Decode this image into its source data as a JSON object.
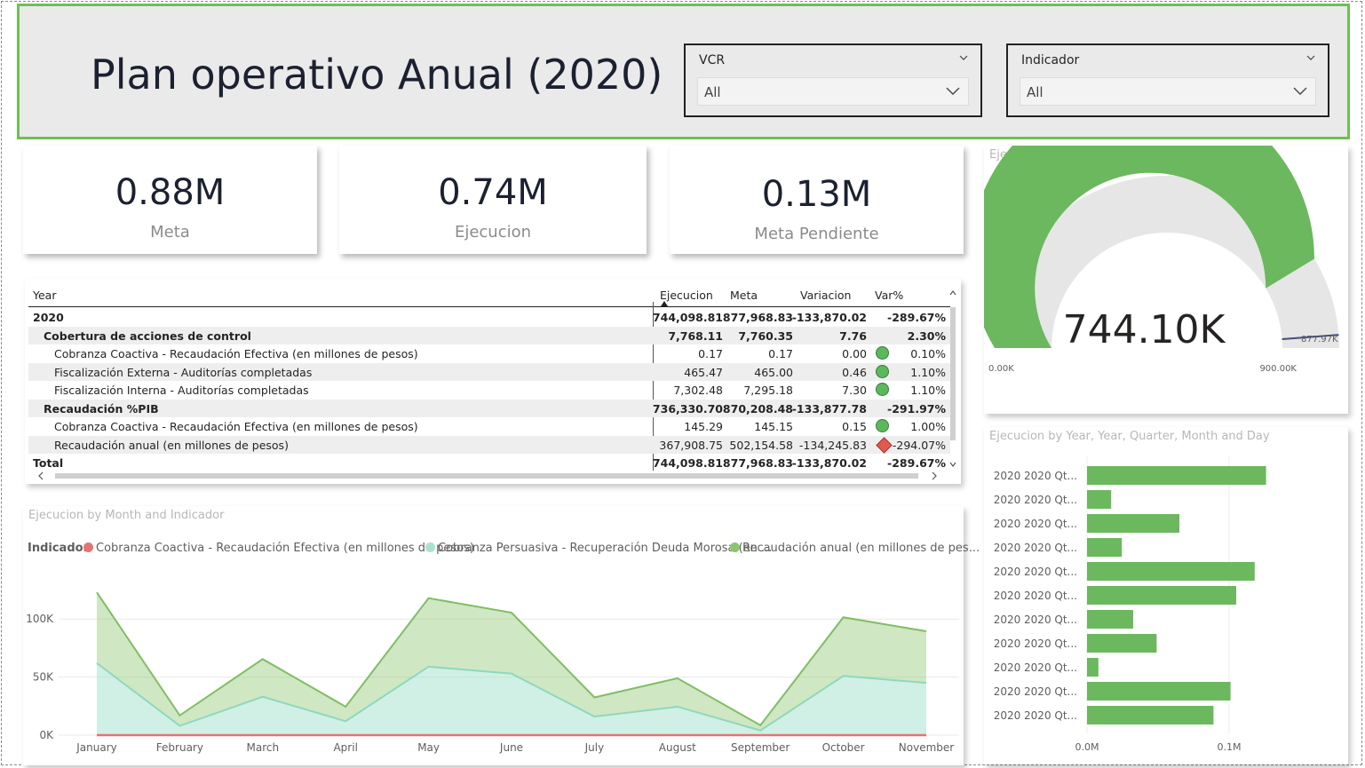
{
  "header": {
    "title": "Plan operativo Anual (2020)",
    "slicers": [
      {
        "label": "VCR",
        "value": "All"
      },
      {
        "label": "Indicador",
        "value": "All"
      }
    ]
  },
  "cards": [
    {
      "value": "0.88M",
      "label": "Meta"
    },
    {
      "value": "0.74M",
      "label": "Ejecucion"
    },
    {
      "value": "0.13M",
      "label": "Meta Pendiente"
    }
  ],
  "table": {
    "headers": [
      "Year",
      "Ejecucion",
      "Meta",
      "Variacion",
      "Var%"
    ],
    "rows": [
      {
        "label": "2020",
        "ejecucion": "744,098.81",
        "meta": "877,968.83",
        "variacion": "-133,870.02",
        "var": "-289.67%",
        "level": 0,
        "bold": true,
        "kpi": ""
      },
      {
        "label": "Cobertura de acciones de control",
        "ejecucion": "7,768.11",
        "meta": "7,760.35",
        "variacion": "7.76",
        "var": "2.30%",
        "level": 1,
        "bold": true,
        "kpi": ""
      },
      {
        "label": "Cobranza Coactiva - Recaudación Efectiva (en millones de pesos)",
        "ejecucion": "0.17",
        "meta": "0.17",
        "variacion": "0.00",
        "var": "0.10%",
        "level": 2,
        "bold": false,
        "kpi": "good"
      },
      {
        "label": "Fiscalización Externa - Auditorías completadas",
        "ejecucion": "465.47",
        "meta": "465.00",
        "variacion": "0.46",
        "var": "1.10%",
        "level": 2,
        "bold": false,
        "kpi": "good"
      },
      {
        "label": "Fiscalización Interna - Auditorías completadas",
        "ejecucion": "7,302.48",
        "meta": "7,295.18",
        "variacion": "7.30",
        "var": "1.10%",
        "level": 2,
        "bold": false,
        "kpi": "good"
      },
      {
        "label": "Recaudación %PIB",
        "ejecucion": "736,330.70",
        "meta": "870,208.48",
        "variacion": "-133,877.78",
        "var": "-291.97%",
        "level": 1,
        "bold": true,
        "kpi": ""
      },
      {
        "label": "Cobranza Coactiva - Recaudación Efectiva (en millones de pesos)",
        "ejecucion": "145.29",
        "meta": "145.15",
        "variacion": "0.15",
        "var": "1.00%",
        "level": 2,
        "bold": false,
        "kpi": "good"
      },
      {
        "label": "Recaudación anual (en millones de pesos)",
        "ejecucion": "367,908.75",
        "meta": "502,154.58",
        "variacion": "-134,245.83",
        "var": "-294.07%",
        "level": 2,
        "bold": false,
        "kpi": "bad"
      }
    ],
    "total": {
      "label": "Total",
      "ejecucion": "744,098.81",
      "meta": "877,968.83",
      "variacion": "-133,870.02",
      "var": "-289.67%"
    }
  },
  "colors": {
    "accent": "#6fbf55",
    "bar": "#6cb85e",
    "area_dark": "#8cc56f",
    "area_light": "#a9e3cf",
    "line_red": "#e57373",
    "gauge_bg": "#e6e6e6",
    "gauge_target": "#3f4f7a"
  },
  "chart_data": [
    {
      "type": "gauge",
      "title": "Ejecucion and Meta",
      "value": 744100,
      "value_label": "744.10K",
      "min": 0,
      "min_label": "0.00K",
      "max": 900000,
      "max_label": "900.00K",
      "target": 877970,
      "target_label": "877.97K"
    },
    {
      "type": "bar",
      "orientation": "horizontal",
      "title": "Ejecucion by Year, Year, Quarter, Month and Day",
      "categories": [
        "2020 2020 Qt...",
        "2020 2020 Qt...",
        "2020 2020 Qt...",
        "2020 2020 Qt...",
        "2020 2020 Qt...",
        "2020 2020 Qt...",
        "2020 2020 Qt...",
        "2020 2020 Qt...",
        "2020 2020 Qt...",
        "2020 2020 Qt...",
        "2020 2020 Qt..."
      ],
      "values": [
        126000,
        17000,
        65000,
        24500,
        118000,
        105000,
        32500,
        49000,
        8000,
        101000,
        89000
      ],
      "xlim": [
        0,
        160000
      ],
      "ticks": [
        {
          "v": 0,
          "label": "0.0M"
        },
        {
          "v": 100000,
          "label": "0.1M"
        }
      ]
    },
    {
      "type": "area",
      "title": "Ejecucion by Month and Indicador",
      "legend_title": "Indicador",
      "categories": [
        "January",
        "February",
        "March",
        "April",
        "May",
        "June",
        "July",
        "August",
        "September",
        "October",
        "November"
      ],
      "ylim": [
        0,
        130000
      ],
      "yticks": [
        {
          "v": 0,
          "label": "0K"
        },
        {
          "v": 50000,
          "label": "50K"
        },
        {
          "v": 100000,
          "label": "100K"
        }
      ],
      "series": [
        {
          "name": "Cobranza Coactiva - Recaudación Efectiva (en millones de pesos)",
          "color": "#e57373",
          "values": [
            0,
            0,
            0,
            0,
            0,
            0,
            0,
            0,
            0,
            0,
            0
          ]
        },
        {
          "name": "Cobranza Persuasiva - Recuperación Deuda Morosa (en ...",
          "color": "#a9e3cf",
          "values": [
            62000,
            8000,
            33000,
            12000,
            59000,
            53000,
            16000,
            24500,
            4000,
            51000,
            45000
          ]
        },
        {
          "name": "Recaudación anual (en millones de pes...",
          "color": "#8cc56f",
          "values": [
            61000,
            9000,
            32500,
            12500,
            59000,
            52500,
            16500,
            24500,
            4500,
            50500,
            44500
          ]
        }
      ]
    }
  ]
}
